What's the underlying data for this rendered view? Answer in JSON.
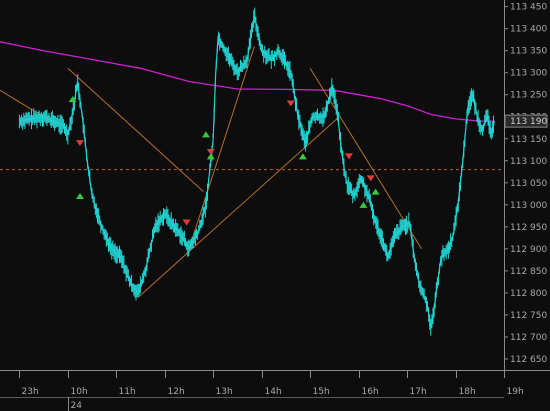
{
  "chart_data": {
    "type": "line",
    "instrument": "",
    "last_price_label": "113 190",
    "y_axis": {
      "ylim": [
        112.625,
        113.465
      ],
      "ticks": [
        "113 450",
        "113 400",
        "113 350",
        "113 300",
        "113 250",
        "113 200",
        "113 150",
        "113 100",
        "113 050",
        "113 000",
        "112 950",
        "112 900",
        "112 850",
        "112 800",
        "112 750",
        "112 700",
        "112 650"
      ],
      "tick_values": [
        113.45,
        113.4,
        113.35,
        113.3,
        113.25,
        113.2,
        113.15,
        113.1,
        113.05,
        113.0,
        112.95,
        112.9,
        112.85,
        112.8,
        112.75,
        112.7,
        112.65
      ]
    },
    "x_axis": {
      "date_label": "24",
      "hour_labels": [
        "23h",
        "10h",
        "11h",
        "12h",
        "13h",
        "14h",
        "15h",
        "16h",
        "17h",
        "18h",
        "19h"
      ]
    },
    "horizontal_line": {
      "value": 113.08,
      "style": "dashed",
      "color": "#c06020"
    },
    "price_color": "#22d4d4",
    "ma_color": "#d020d0",
    "trendline_color": "#b86e2a",
    "price_points": [
      [
        23.0,
        113.19
      ],
      [
        23.5,
        113.2
      ],
      [
        23.9,
        113.18
      ],
      [
        24.0,
        113.16
      ],
      [
        24.1,
        113.21
      ],
      [
        24.2,
        113.28
      ],
      [
        24.3,
        113.2
      ],
      [
        24.4,
        113.1
      ],
      [
        24.5,
        113.02
      ],
      [
        24.7,
        112.95
      ],
      [
        24.9,
        112.9
      ],
      [
        25.1,
        112.88
      ],
      [
        25.3,
        112.82
      ],
      [
        25.45,
        112.8
      ],
      [
        25.6,
        112.85
      ],
      [
        25.8,
        112.95
      ],
      [
        26.0,
        112.98
      ],
      [
        26.2,
        112.95
      ],
      [
        26.35,
        112.93
      ],
      [
        26.5,
        112.9
      ],
      [
        26.7,
        112.94
      ],
      [
        26.85,
        113.0
      ],
      [
        27.0,
        113.15
      ],
      [
        27.05,
        113.3
      ],
      [
        27.1,
        113.38
      ],
      [
        27.25,
        113.35
      ],
      [
        27.5,
        113.3
      ],
      [
        27.7,
        113.33
      ],
      [
        27.85,
        113.43
      ],
      [
        28.0,
        113.35
      ],
      [
        28.2,
        113.33
      ],
      [
        28.35,
        113.35
      ],
      [
        28.5,
        113.32
      ],
      [
        28.6,
        113.3
      ],
      [
        28.75,
        113.2
      ],
      [
        28.9,
        113.14
      ],
      [
        29.05,
        113.2
      ],
      [
        29.3,
        113.2
      ],
      [
        29.45,
        113.27
      ],
      [
        29.55,
        113.22
      ],
      [
        29.65,
        113.12
      ],
      [
        29.75,
        113.05
      ],
      [
        29.9,
        113.02
      ],
      [
        30.05,
        113.06
      ],
      [
        30.2,
        113.02
      ],
      [
        30.35,
        112.96
      ],
      [
        30.5,
        112.92
      ],
      [
        30.6,
        112.88
      ],
      [
        30.75,
        112.93
      ],
      [
        30.9,
        112.95
      ],
      [
        31.05,
        112.96
      ],
      [
        31.15,
        112.88
      ],
      [
        31.25,
        112.82
      ],
      [
        31.4,
        112.78
      ],
      [
        31.5,
        112.72
      ],
      [
        31.6,
        112.8
      ],
      [
        31.7,
        112.88
      ],
      [
        31.85,
        112.9
      ],
      [
        31.95,
        112.93
      ],
      [
        32.05,
        113.0
      ],
      [
        32.15,
        113.1
      ],
      [
        32.25,
        113.22
      ],
      [
        32.35,
        113.25
      ],
      [
        32.45,
        113.2
      ],
      [
        32.55,
        113.17
      ],
      [
        32.65,
        113.2
      ],
      [
        32.75,
        113.16
      ],
      [
        32.8,
        113.19
      ]
    ],
    "ma_points": [
      [
        22.6,
        113.37
      ],
      [
        23.5,
        113.35
      ],
      [
        24.5,
        113.33
      ],
      [
        25.5,
        113.31
      ],
      [
        26.5,
        113.28
      ],
      [
        27.5,
        113.263
      ],
      [
        28.5,
        113.262
      ],
      [
        29.5,
        113.26
      ],
      [
        30.0,
        113.25
      ],
      [
        30.5,
        113.24
      ],
      [
        31.0,
        113.225
      ],
      [
        31.5,
        113.205
      ],
      [
        32.0,
        113.195
      ],
      [
        32.5,
        113.19
      ],
      [
        32.8,
        113.19
      ]
    ],
    "trendlines": [
      [
        [
          22.6,
          113.26
        ],
        [
          23.8,
          113.18
        ]
      ],
      [
        [
          24.0,
          113.31
        ],
        [
          26.8,
          113.03
        ]
      ],
      [
        [
          25.45,
          112.79
        ],
        [
          29.6,
          113.2
        ]
      ],
      [
        [
          26.5,
          112.9
        ],
        [
          27.85,
          113.36
        ]
      ],
      [
        [
          29.0,
          113.31
        ],
        [
          31.3,
          112.9
        ]
      ]
    ],
    "signals_up": [
      [
        24.1,
        113.24
      ],
      [
        24.25,
        113.02
      ],
      [
        26.85,
        113.16
      ],
      [
        26.95,
        113.11
      ],
      [
        28.85,
        113.11
      ],
      [
        30.1,
        113.0
      ],
      [
        30.35,
        113.03
      ]
    ],
    "signals_down": [
      [
        24.25,
        113.14
      ],
      [
        26.45,
        112.96
      ],
      [
        26.95,
        113.12
      ],
      [
        28.6,
        113.23
      ],
      [
        29.8,
        113.11
      ],
      [
        30.25,
        113.06
      ]
    ]
  }
}
